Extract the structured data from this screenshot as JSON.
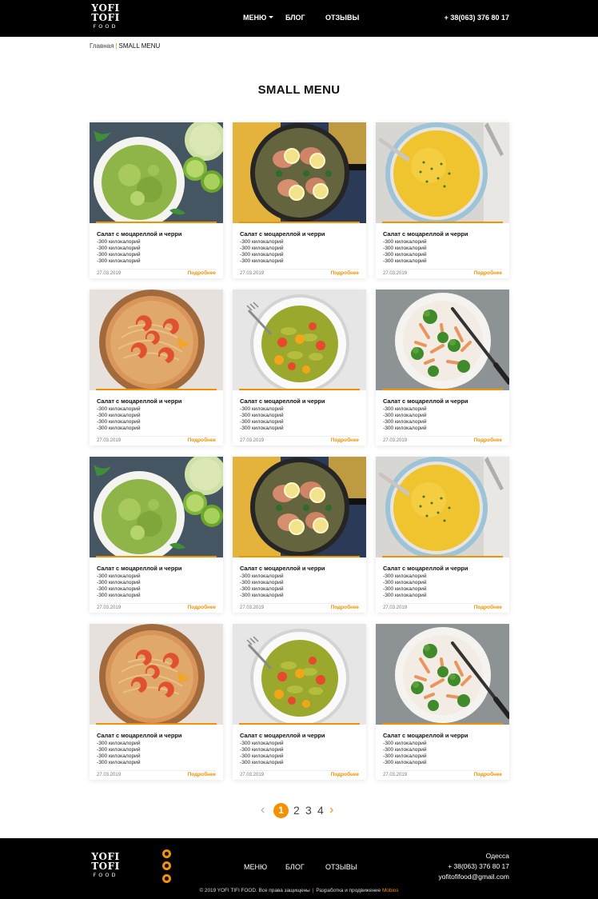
{
  "header": {
    "logo": {
      "line1": "YOFI",
      "line2": "TOFI",
      "line3": "FOOD"
    },
    "nav": {
      "menu": "МЕНЮ",
      "blog": "БЛОГ",
      "reviews": "ОТЗЫВЫ"
    },
    "phone": "+ 38(063) 376 80 17"
  },
  "breadcrumb": {
    "home": "Главная",
    "separator": "|",
    "current": "SMALL MENU"
  },
  "page_title": "SMALL MENU",
  "cards": [
    {
      "title": "Салат с моцареллой и черри",
      "info": [
        "-300 килокалорий",
        "-300 килокалорий",
        "-300 килокалорий",
        "-300 килокалорий"
      ],
      "date": "27.03.2019",
      "more": "Подробнее",
      "image": "guacamole"
    },
    {
      "title": "Салат с моцареллой и черри",
      "info": [
        "-300 килокалорий",
        "-300 килокалорий",
        "-300 килокалорий",
        "-300 килокалорий"
      ],
      "date": "27.03.2019",
      "more": "Подробнее",
      "image": "chicken-lemon"
    },
    {
      "title": "Салат с моцареллой и черри",
      "info": [
        "-300 килокалорий",
        "-300 килокалорий",
        "-300 килокалорий",
        "-300 килокалорий"
      ],
      "date": "27.03.2019",
      "more": "Подробнее",
      "image": "corn-soup"
    },
    {
      "title": "Салат с моцареллой и черри",
      "info": [
        "-300 килокалорий",
        "-300 килокалорий",
        "-300 килокалорий",
        "-300 килокалорий"
      ],
      "date": "27.03.2019",
      "more": "Подробнее",
      "image": "shrimp-pasta"
    },
    {
      "title": "Салат с моцареллой и черри",
      "info": [
        "-300 килокалорий",
        "-300 килокалорий",
        "-300 килокалорий",
        "-300 килокалорий"
      ],
      "date": "27.03.2019",
      "more": "Подробнее",
      "image": "pesto-fusilli"
    },
    {
      "title": "Салат с моцареллой и черри",
      "info": [
        "-300 килокалорий",
        "-300 килокалорий",
        "-300 килокалорий",
        "-300 килокалорий"
      ],
      "date": "27.03.2019",
      "more": "Подробнее",
      "image": "broccoli-pasta"
    },
    {
      "title": "Салат с моцареллой и черри",
      "info": [
        "-300 килокалорий",
        "-300 килокалорий",
        "-300 килокалорий",
        "-300 килокалорий"
      ],
      "date": "27.03.2019",
      "more": "Подробнее",
      "image": "guacamole"
    },
    {
      "title": "Салат с моцареллой и черри",
      "info": [
        "-300 килокалорий",
        "-300 килокалорий",
        "-300 килокалорий",
        "-300 килокалорий"
      ],
      "date": "27.03.2019",
      "more": "Подробнее",
      "image": "chicken-lemon"
    },
    {
      "title": "Салат с моцареллой и черри",
      "info": [
        "-300 килокалорий",
        "-300 килокалорий",
        "-300 килокалорий",
        "-300 килокалорий"
      ],
      "date": "27.03.2019",
      "more": "Подробнее",
      "image": "corn-soup"
    },
    {
      "title": "Салат с моцареллой и черри",
      "info": [
        "-300 килокалорий",
        "-300 килокалорий",
        "-300 килокалорий",
        "-300 килокалорий"
      ],
      "date": "27.03.2019",
      "more": "Подробнее",
      "image": "shrimp-pasta"
    },
    {
      "title": "Салат с моцареллой и черри",
      "info": [
        "-300 килокалорий",
        "-300 килокалорий",
        "-300 килокалорий",
        "-300 килокалорий"
      ],
      "date": "27.03.2019",
      "more": "Подробнее",
      "image": "pesto-fusilli"
    },
    {
      "title": "Салат с моцареллой и черри",
      "info": [
        "-300 килокалорий",
        "-300 килокалорий",
        "-300 килокалорий",
        "-300 килокалорий"
      ],
      "date": "27.03.2019",
      "more": "Подробнее",
      "image": "broccoli-pasta"
    }
  ],
  "pagination": {
    "prev": "‹",
    "pages": [
      "1",
      "2",
      "3",
      "4"
    ],
    "current": "1",
    "next": "›"
  },
  "footer": {
    "logo": {
      "line1": "YOFI",
      "line2": "TOFI",
      "line3": "FOOD"
    },
    "social": [
      "telegram-icon",
      "facebook-icon",
      "instagram-icon"
    ],
    "nav": {
      "menu": "МЕНЮ",
      "blog": "БЛОГ",
      "reviews": "ОТЗЫВЫ"
    },
    "city": "Одесса",
    "phone": "+ 38(063) 376 80 17",
    "email": "yofitofifood@gmail.com",
    "copyright": "© 2019 YOFI TIFI FOOD. Все права защищены",
    "separator": "|",
    "dev_text": "Разработка и продвижение",
    "dev_brand": "Mobios"
  },
  "colors": {
    "accent": "#f39200",
    "header_bg": "#000000"
  }
}
